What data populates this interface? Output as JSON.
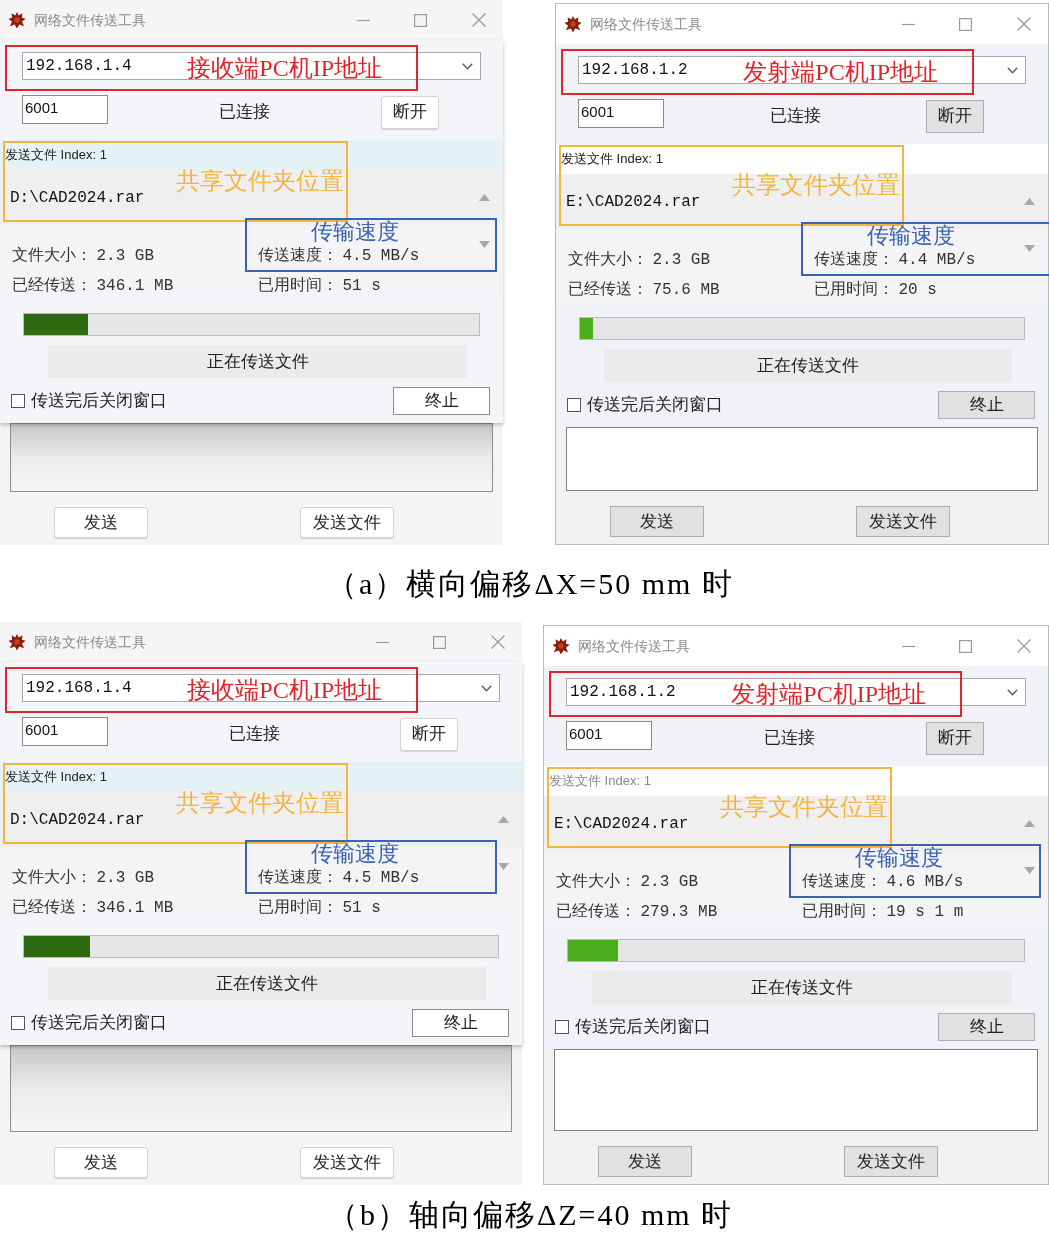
{
  "panels": [
    {
      "windows": [
        {
          "title": "网络文件传送工具",
          "ip_address": "192.168.1.4",
          "port": "6001",
          "connection_status": "已连接",
          "disconnect_button": "断开",
          "file_header": "发送文件 Index: 1",
          "file_path": "D:\\CAD2024.rar",
          "stats": [
            {
              "label": "文件大小：",
              "value": "2.3 GB"
            },
            {
              "label": "传送速度：",
              "value": "4.5 MB/s"
            },
            {
              "label": "已经传送：",
              "value": "346.1 MB"
            },
            {
              "label": "已用时间：",
              "value": "51 s"
            }
          ],
          "progress": {
            "level": 0.14
          },
          "status_text": "正在传送文件",
          "close_after_send": {
            "label": "传送完后关闭窗口",
            "checked": false
          },
          "stop_button": "终止",
          "send_button": "发送",
          "send_file_button": "发送文件",
          "annotations": [
            {
              "kind": "ip",
              "text": "接收端PC机IP地址",
              "color": "#e3242b"
            },
            {
              "kind": "path",
              "text": "共享文件夹位置",
              "color": "#f2b53e"
            },
            {
              "kind": "speed",
              "text": "传输速度",
              "color": "#3b63b5"
            }
          ]
        },
        {
          "title": "网络文件传送工具",
          "ip_address": "192.168.1.2",
          "port": "6001",
          "connection_status": "已连接",
          "disconnect_button": "断开",
          "file_header": "发送文件 Index: 1",
          "file_path": "E:\\CAD2024.rar",
          "stats": [
            {
              "label": "文件大小：",
              "value": "2.3 GB"
            },
            {
              "label": "传送速度：",
              "value": "4.4 MB/s"
            },
            {
              "label": "已经传送：",
              "value": "75.6 MB"
            },
            {
              "label": "已用时间：",
              "value": "20 s"
            }
          ],
          "progress": {
            "level": 0.03
          },
          "status_text": "正在传送文件",
          "close_after_send": {
            "label": "传送完后关闭窗口",
            "checked": false
          },
          "stop_button": "终止",
          "send_button": "发送",
          "send_file_button": "发送文件",
          "annotations": [
            {
              "kind": "ip",
              "text": "发射端PC机IP地址",
              "color": "#e3242b"
            },
            {
              "kind": "path",
              "text": "共享文件夹位置",
              "color": "#f2b53e"
            },
            {
              "kind": "speed",
              "text": "传输速度",
              "color": "#3b63b5"
            }
          ]
        }
      ],
      "caption": "（a）横向偏移ΔX=50 mm 时"
    },
    {
      "windows": [
        {
          "title": "网络文件传送工具",
          "ip_address": "192.168.1.4",
          "port": "6001",
          "connection_status": "已连接",
          "disconnect_button": "断开",
          "file_header": "发送文件 Index: 1",
          "file_path": "D:\\CAD2024.rar",
          "stats": [
            {
              "label": "文件大小：",
              "value": "2.3 GB"
            },
            {
              "label": "传送速度：",
              "value": "4.5 MB/s"
            },
            {
              "label": "已经传送：",
              "value": "346.1 MB"
            },
            {
              "label": "已用时间：",
              "value": "51 s"
            }
          ],
          "progress": {
            "level": 0.14
          },
          "status_text": "正在传送文件",
          "close_after_send": {
            "label": "传送完后关闭窗口",
            "checked": false
          },
          "stop_button": "终止",
          "send_button": "发送",
          "send_file_button": "发送文件",
          "annotations": [
            {
              "kind": "ip",
              "text": "接收端PC机IP地址",
              "color": "#e3242b"
            },
            {
              "kind": "path",
              "text": "共享文件夹位置",
              "color": "#f2b53e"
            },
            {
              "kind": "speed",
              "text": "传输速度",
              "color": "#3b63b5"
            }
          ]
        },
        {
          "title": "网络文件传送工具",
          "ip_address": "192.168.1.2",
          "port": "6001",
          "connection_status": "已连接",
          "disconnect_button": "断开",
          "file_header": "发送文件 Index: 1",
          "file_path": "E:\\CAD2024.rar",
          "stats": [
            {
              "label": "文件大小：",
              "value": "2.3 GB"
            },
            {
              "label": "传送速度：",
              "value": "4.6 MB/s"
            },
            {
              "label": "已经传送：",
              "value": "279.3 MB"
            },
            {
              "label": "已用时间：",
              "value": "19 s 1 m"
            }
          ],
          "progress": {
            "level": 0.11
          },
          "status_text": "正在传送文件",
          "close_after_send": {
            "label": "传送完后关闭窗口",
            "checked": false
          },
          "stop_button": "终止",
          "send_button": "发送",
          "send_file_button": "发送文件",
          "annotations": [
            {
              "kind": "ip",
              "text": "发射端PC机IP地址",
              "color": "#e3242b"
            },
            {
              "kind": "path",
              "text": "共享文件夹位置",
              "color": "#f2b53e"
            },
            {
              "kind": "speed",
              "text": "传输速度",
              "color": "#3b63b5"
            }
          ]
        }
      ],
      "caption": "（b）轴向偏移ΔZ=40 mm 时"
    }
  ]
}
